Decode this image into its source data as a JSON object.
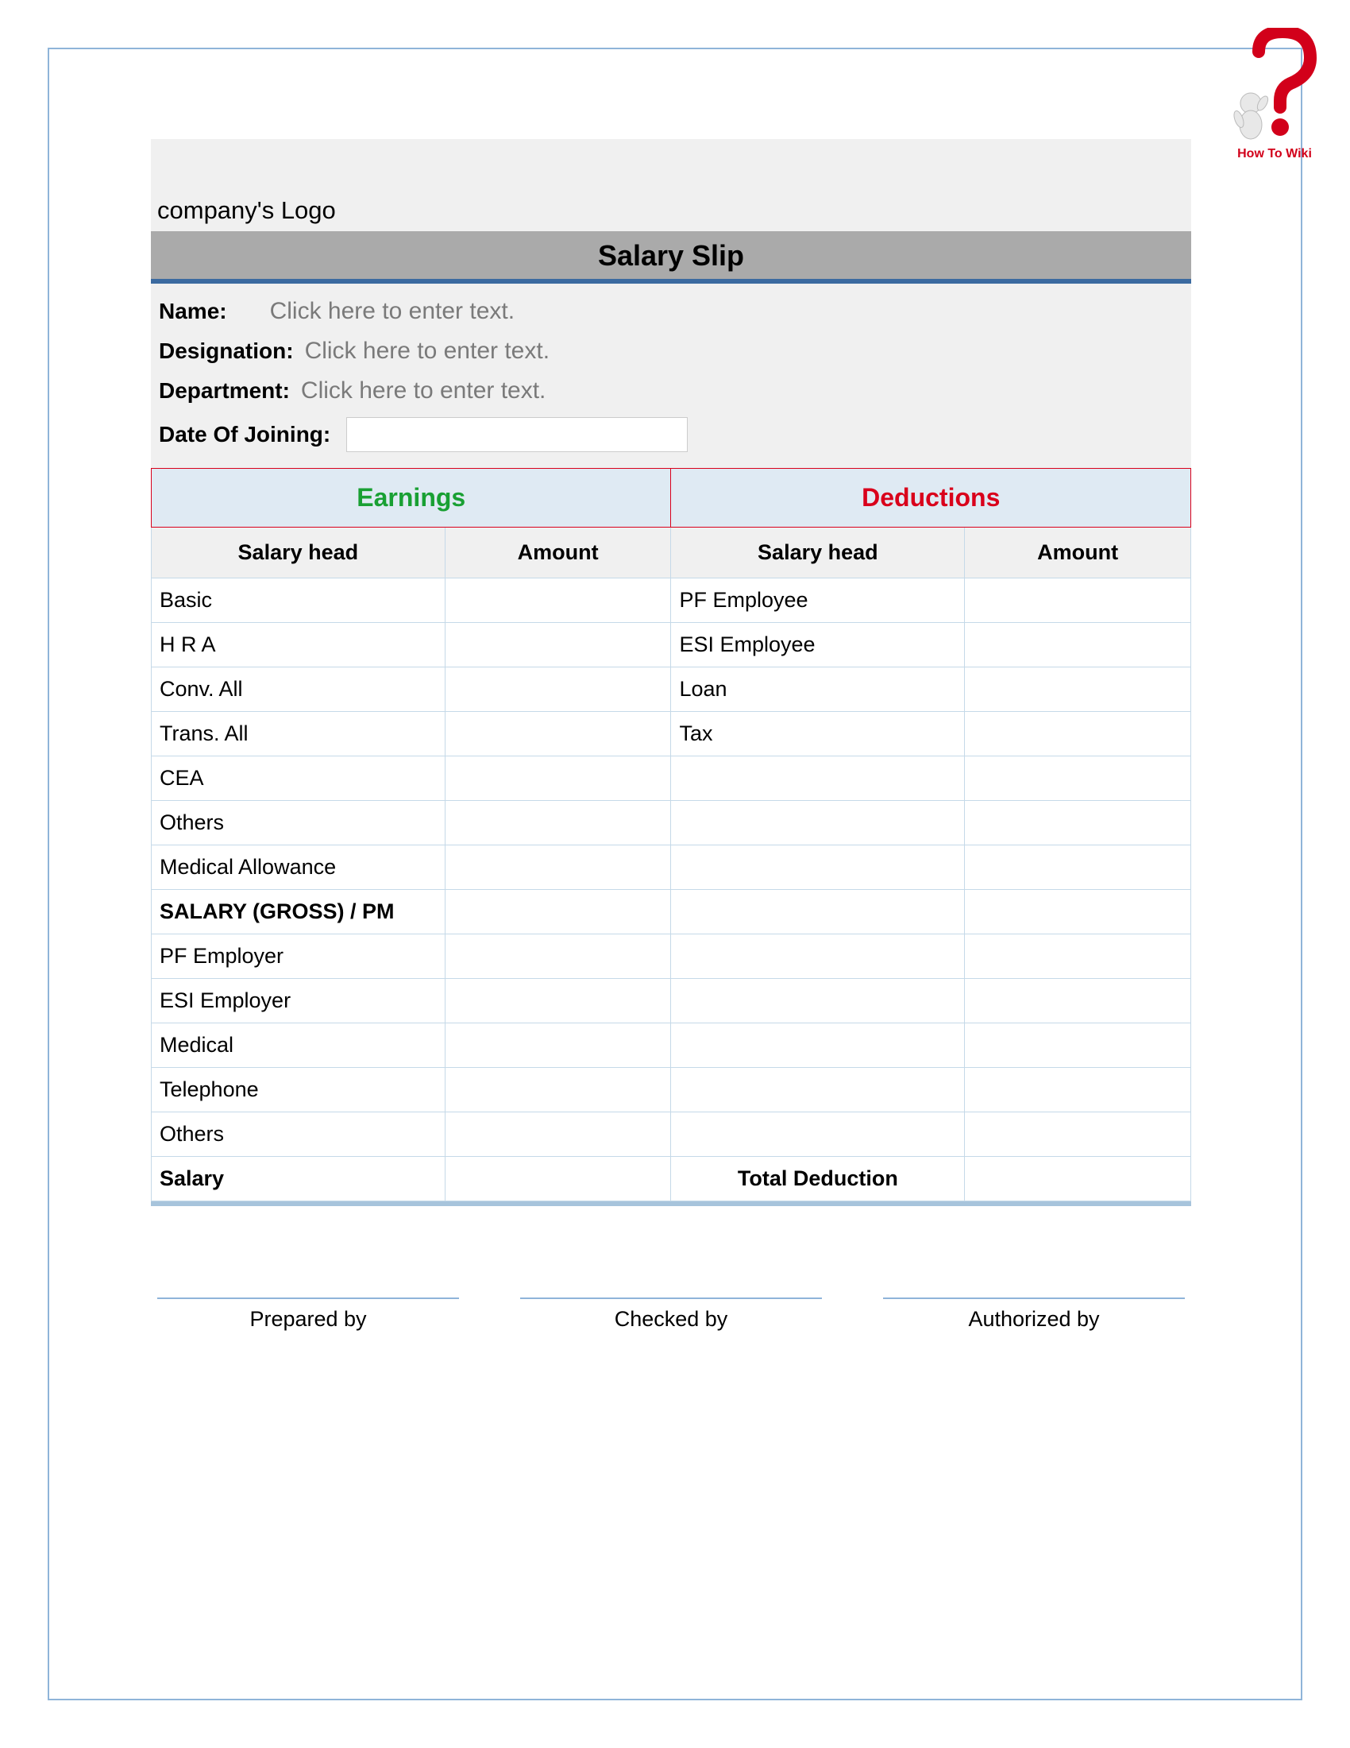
{
  "watermark": {
    "label": "How To Wiki"
  },
  "header": {
    "logo_text": "company's Logo",
    "title": "Salary Slip"
  },
  "info": {
    "name_label": "Name:",
    "name_placeholder": "Click here to enter text.",
    "designation_label": "Designation:",
    "designation_placeholder": "Click here to enter text.",
    "department_label": "Department:",
    "department_placeholder": "Click here to enter text.",
    "doj_label": "Date Of Joining:"
  },
  "sections": {
    "earnings": "Earnings",
    "deductions": "Deductions",
    "salary_head": "Salary head",
    "amount": "Amount"
  },
  "rows": [
    {
      "e_head": "Basic",
      "e_amt": "",
      "d_head": "PF Employee",
      "d_amt": ""
    },
    {
      "e_head": "H R A",
      "e_amt": "",
      "d_head": "ESI Employee",
      "d_amt": ""
    },
    {
      "e_head": "Conv. All",
      "e_amt": "",
      "d_head": "Loan",
      "d_amt": ""
    },
    {
      "e_head": "Trans. All",
      "e_amt": "",
      "d_head": "Tax",
      "d_amt": ""
    },
    {
      "e_head": "CEA",
      "e_amt": "",
      "d_head": "",
      "d_amt": ""
    },
    {
      "e_head": "Others",
      "e_amt": "",
      "d_head": "",
      "d_amt": ""
    },
    {
      "e_head": "Medical Allowance",
      "e_amt": "",
      "d_head": "",
      "d_amt": ""
    },
    {
      "e_head": "SALARY (GROSS) / PM",
      "e_amt": "",
      "d_head": "",
      "d_amt": "",
      "bold": true
    },
    {
      "e_head": "PF Employer",
      "e_amt": "",
      "d_head": "",
      "d_amt": ""
    },
    {
      "e_head": "ESI Employer",
      "e_amt": "",
      "d_head": "",
      "d_amt": ""
    },
    {
      "e_head": "Medical",
      "e_amt": "",
      "d_head": "",
      "d_amt": ""
    },
    {
      "e_head": "Telephone",
      "e_amt": "",
      "d_head": "",
      "d_amt": ""
    },
    {
      "e_head": "Others",
      "e_amt": "",
      "d_head": "",
      "d_amt": ""
    },
    {
      "e_head": "Salary",
      "e_amt": "",
      "d_head": "Total Deduction",
      "d_amt": "",
      "bold": true,
      "d_center": true
    }
  ],
  "signatures": {
    "prepared": "Prepared by",
    "checked": "Checked by",
    "authorized": "Authorized by"
  }
}
